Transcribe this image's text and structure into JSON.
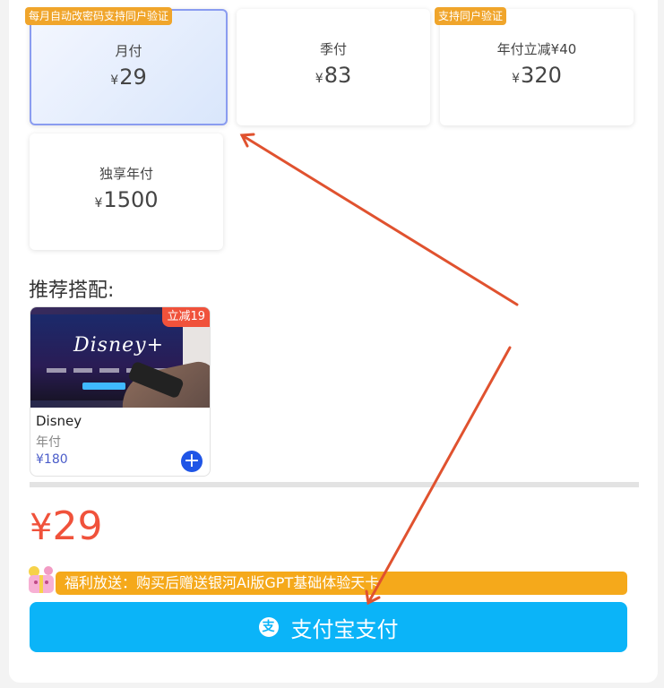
{
  "plans": [
    {
      "name": "月付",
      "currency": "¥",
      "price": "29",
      "tag": "每月自动改密码支持同户验证",
      "selected": true
    },
    {
      "name": "季付",
      "currency": "¥",
      "price": "83",
      "tag": ""
    },
    {
      "name": "年付立减¥40",
      "currency": "¥",
      "price": "320",
      "tag": "支持同户验证"
    },
    {
      "name": "独享年付",
      "currency": "¥",
      "price": "1500",
      "tag": ""
    }
  ],
  "recommend": {
    "title": "推荐搭配:",
    "addon": {
      "badge": "立减19",
      "name": "Disney",
      "period": "年付",
      "price": "¥180",
      "image_text": "Disney+"
    }
  },
  "total": {
    "currency": "¥",
    "amount": "29"
  },
  "promo": {
    "text": "福利放送：购买后赠送银河Ai版GPT基础体验天卡"
  },
  "pay_button": {
    "label": "支付宝支付",
    "icon": "alipay-icon"
  },
  "colors": {
    "accent": "#0bb4f8",
    "price_red": "#f0523b",
    "tag_orange": "#f0a52b",
    "annotation_arrow": "#e0522f"
  }
}
